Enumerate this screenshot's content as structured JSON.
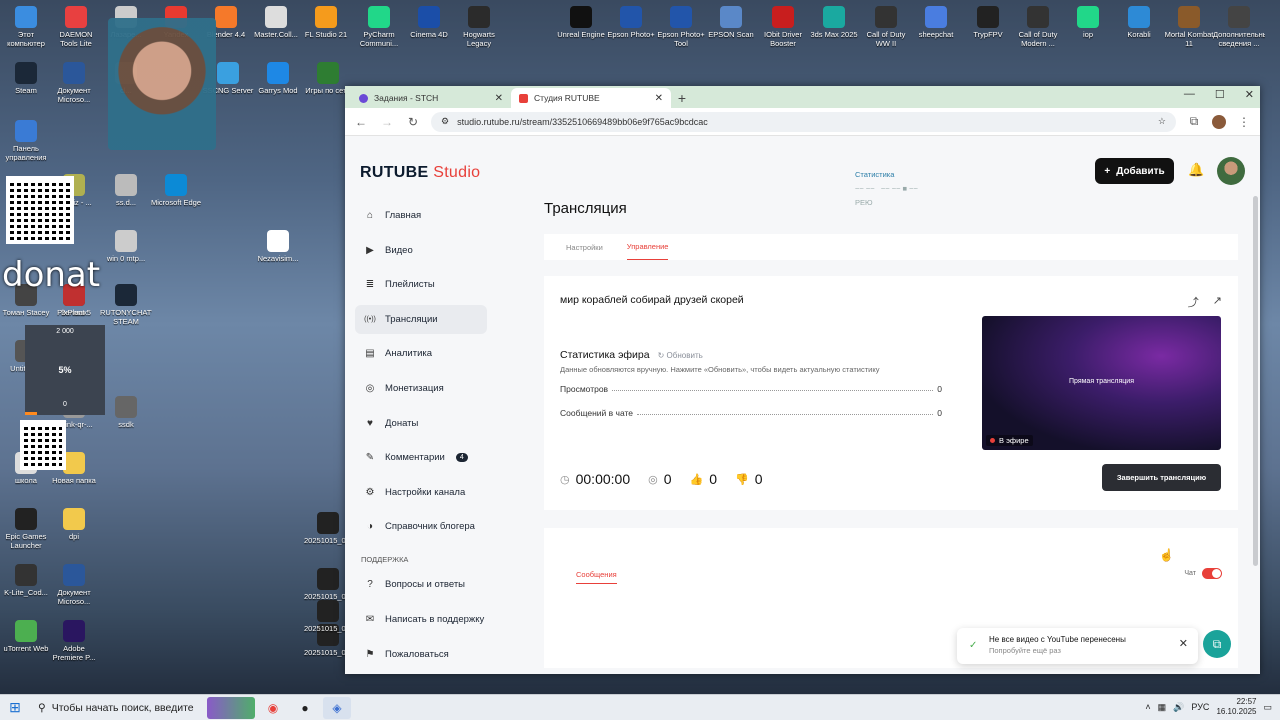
{
  "desktop": {
    "icons": [
      {
        "label": "Этот компьютер",
        "color": "#3b8de0"
      },
      {
        "label": "DAEMON Tools Lite",
        "color": "#e84040"
      },
      {
        "label": "Лазаре...",
        "color": "#cccccc"
      },
      {
        "label": "Yandex",
        "color": "#e83a30"
      },
      {
        "label": "Blender 4.4",
        "color": "#f5792a"
      },
      {
        "label": "Master.Coll...",
        "color": "#dddddd"
      },
      {
        "label": "FL Studio 21",
        "color": "#f59b1c"
      },
      {
        "label": "PyCharm Communi...",
        "color": "#21d789"
      },
      {
        "label": "Cinema 4D",
        "color": "#1b4ea8"
      },
      {
        "label": "Hogwarts Legacy",
        "color": "#2b2b2b"
      },
      {
        "label": "Unreal Engine",
        "color": "#111111"
      },
      {
        "label": "Epson Photo+",
        "color": "#2255aa"
      },
      {
        "label": "Epson Photo+ Tool",
        "color": "#2255aa"
      },
      {
        "label": "EPSON Scan",
        "color": "#5a88c8"
      },
      {
        "label": "IObit Driver Booster",
        "color": "#c81e1e"
      },
      {
        "label": "3ds Max 2025",
        "color": "#1aa9a0"
      },
      {
        "label": "Call of Duty WW II",
        "color": "#333333"
      },
      {
        "label": "sheepchat",
        "color": "#4a7de0"
      },
      {
        "label": "TrypFPV",
        "color": "#222222"
      },
      {
        "label": "Call of Duty Modern ...",
        "color": "#333333"
      },
      {
        "label": "iop",
        "color": "#21d789"
      },
      {
        "label": "Korabli",
        "color": "#2d8ad6"
      },
      {
        "label": "Mortal Kombat 11",
        "color": "#8a5a2a"
      },
      {
        "label": "Дополнительные сведения ...",
        "color": "#444444"
      },
      {
        "label": "Steam",
        "color": "#1b2838"
      },
      {
        "label": "Документ Microso...",
        "color": "#2b579a"
      },
      {
        "label": "cl...",
        "color": "#888888"
      },
      {
        "label": "SSCNG Server",
        "color": "#3aa0e0"
      },
      {
        "label": "Garrys Mod",
        "color": "#1e88e5"
      },
      {
        "label": "Игры по сети",
        "color": "#2e7d32"
      },
      {
        "label": "Панель управления",
        "color": "#3a7bd5"
      },
      {
        "label": "Microsoft Edge",
        "color": "#0c8ad6"
      },
      {
        "label": "ss.d...",
        "color": "#bbbbbb"
      },
      {
        "label": "ernetiz - ...",
        "color": "#b0b050"
      },
      {
        "label": "win 0 mtp...",
        "color": "#cccccc"
      },
      {
        "label": "Nezavisim...",
        "color": "#ffffff"
      },
      {
        "label": "Зелмах",
        "color": "#333333"
      },
      {
        "label": "Томан Stacey",
        "color": "#444444"
      },
      {
        "label": "PixPlant 5",
        "color": "#c03030"
      },
      {
        "label": "RUTONYCHAT'S STEAM",
        "color": "#1b2838"
      },
      {
        "label": "Untitled 1",
        "color": "#555555"
      },
      {
        "label": "ssdk",
        "color": "#666666"
      },
      {
        "label": "dalink-qr-...",
        "color": "#999999"
      },
      {
        "label": "школа",
        "color": "#dddddd"
      },
      {
        "label": "Новая папка",
        "color": "#f2c94c"
      },
      {
        "label": "Epic Games Launcher",
        "color": "#222222"
      },
      {
        "label": "dpi",
        "color": "#f2c94c"
      },
      {
        "label": "20251015_0...",
        "color": "#222222"
      },
      {
        "label": "K-Lite_Cod...",
        "color": "#333333"
      },
      {
        "label": "Документ Microso...",
        "color": "#2b579a"
      },
      {
        "label": "20251015_0...",
        "color": "#222222"
      },
      {
        "label": "uTorrent Web",
        "color": "#4caf50"
      },
      {
        "label": "Adobe Premiere P...",
        "color": "#2a1660"
      },
      {
        "label": "20251015_0...",
        "color": "#222222"
      },
      {
        "label": "20251015_0...",
        "color": "#222222"
      }
    ],
    "overlay_text": "donat",
    "gauge": {
      "top": "2 000",
      "percent": "5%",
      "bottom": "0",
      "fill": 0.05
    }
  },
  "taskbar": {
    "search_placeholder": "Чтобы начать поиск, введите",
    "time": "22:57",
    "date": "16.10.2025"
  },
  "browser": {
    "tabs": [
      {
        "title": "Задания - STCH",
        "active": false
      },
      {
        "title": "Студия RUTUBE",
        "active": true
      }
    ],
    "url": "studio.rutube.ru/stream/3352510669489bb06e9f765ac9bcdcac"
  },
  "studio": {
    "logo": "RUTUBE",
    "logo_suffix": "Studio",
    "stats_overlay": "Статистика",
    "stats_overlay_sub": "РЕЮ",
    "add_button": "Добавить",
    "sidebar": [
      {
        "label": "Главная",
        "icon": "home-icon",
        "active": false
      },
      {
        "label": "Видео",
        "icon": "video-icon",
        "active": false
      },
      {
        "label": "Плейлисты",
        "icon": "playlist-icon",
        "active": false
      },
      {
        "label": "Трансляции",
        "icon": "broadcast-icon",
        "active": true
      },
      {
        "label": "Аналитика",
        "icon": "analytics-icon",
        "active": false
      },
      {
        "label": "Монетизация",
        "icon": "monetization-icon",
        "active": false
      },
      {
        "label": "Донаты",
        "icon": "donate-icon",
        "active": false
      },
      {
        "label": "Комментарии",
        "icon": "comments-icon",
        "active": false,
        "badge": "4"
      },
      {
        "label": "Настройки канала",
        "icon": "settings-icon",
        "active": false
      },
      {
        "label": "Справочник блогера",
        "icon": "help-icon",
        "active": false
      }
    ],
    "support_heading": "ПОДДЕРЖКА",
    "support_items": [
      {
        "label": "Вопросы и ответы",
        "icon": "faq-icon"
      },
      {
        "label": "Написать в поддержку",
        "icon": "mail-icon"
      },
      {
        "label": "Пожаловаться",
        "icon": "report-icon"
      }
    ],
    "page_title": "Трансляция",
    "page_tabs": [
      {
        "label": "Настройки",
        "active": false
      },
      {
        "label": "Управление",
        "active": true
      }
    ],
    "stream_name": "мир кораблей собирай друзей скорей",
    "stats_title": "Статистика эфира",
    "refresh_label": "Обновить",
    "stats_note": "Данные обновляются вручную. Нажмите «Обновить», чтобы видеть актуальную статистику",
    "stats_rows": [
      {
        "label": "Просмотров",
        "value": "0"
      },
      {
        "label": "Сообщений в чате",
        "value": "0"
      }
    ],
    "timer": "00:00:00",
    "viewers": "0",
    "likes": "0",
    "dislikes": "0",
    "preview_label": "Прямая трансляция",
    "live_label": "В эфире",
    "end_button": "Завершить трансляцию",
    "messages_tab": "Сообщения",
    "chat_label": "Чат",
    "chat_enabled": true,
    "toast_title": "Не все видео с YouTube перенесены",
    "toast_sub": "Попробуйте ещё раз"
  }
}
